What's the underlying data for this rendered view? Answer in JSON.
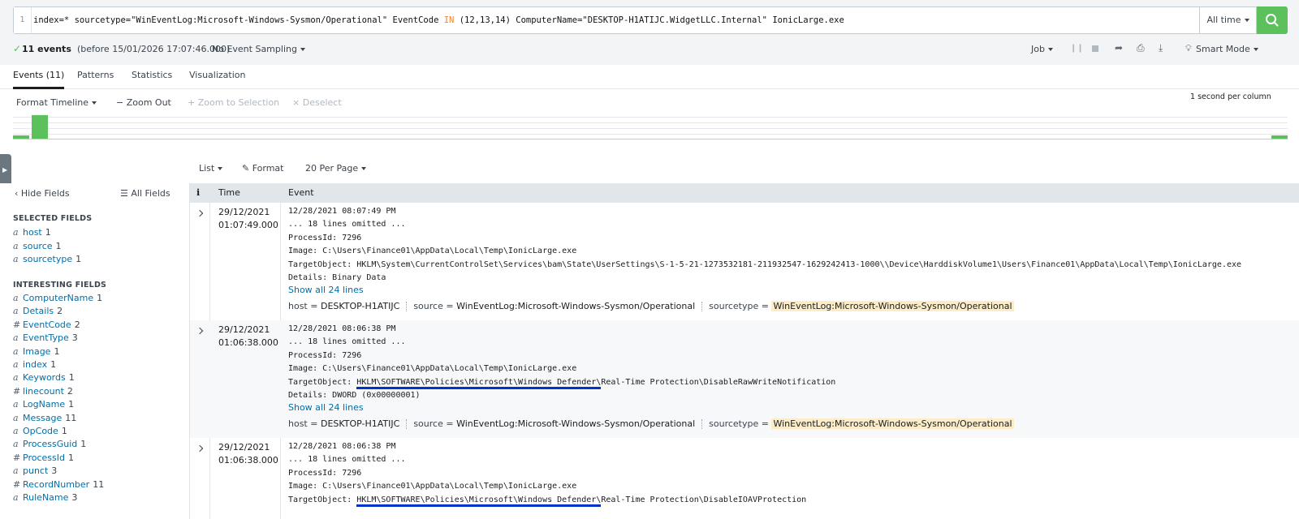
{
  "search": {
    "line_number": "1",
    "query_prefix": "index=* sourcetype=\"WinEventLog:Microsoft-Windows-Sysmon/Operational\" EventCode ",
    "query_keyword": "IN",
    "query_suffix": " (12,13,14) ComputerName=\"DESKTOP-H1ATIJC.WidgetLLC.Internal\" IonicLarge.exe",
    "time_range": "All time",
    "search_icon": "search-icon"
  },
  "status": {
    "event_count": "11 events",
    "before_text": "(before 15/01/2026 17:07:46.000)",
    "sampling": "No Event Sampling",
    "job": "Job",
    "mode": "Smart Mode"
  },
  "tabs": [
    "Events (11)",
    "Patterns",
    "Statistics",
    "Visualization"
  ],
  "timeline": {
    "format": "Format Timeline",
    "zoom_out": "Zoom Out",
    "zoom_selection": "+ Zoom to Selection",
    "deselect": "Deselect",
    "scale": "1 second per column",
    "accent": "#5cc05c"
  },
  "results_toolbar": {
    "list": "List",
    "format": "Format",
    "per_page": "20 Per Page"
  },
  "sidebar": {
    "hide_fields": "Hide Fields",
    "all_fields": "All Fields",
    "selected_heading": "SELECTED FIELDS",
    "interesting_heading": "INTERESTING FIELDS",
    "selected": [
      {
        "type": "a",
        "name": "host",
        "count": "1"
      },
      {
        "type": "a",
        "name": "source",
        "count": "1"
      },
      {
        "type": "a",
        "name": "sourcetype",
        "count": "1"
      }
    ],
    "interesting": [
      {
        "type": "a",
        "name": "ComputerName",
        "count": "1"
      },
      {
        "type": "a",
        "name": "Details",
        "count": "2"
      },
      {
        "type": "#",
        "name": "EventCode",
        "count": "2"
      },
      {
        "type": "a",
        "name": "EventType",
        "count": "3"
      },
      {
        "type": "a",
        "name": "Image",
        "count": "1"
      },
      {
        "type": "a",
        "name": "index",
        "count": "1"
      },
      {
        "type": "a",
        "name": "Keywords",
        "count": "1"
      },
      {
        "type": "#",
        "name": "linecount",
        "count": "2"
      },
      {
        "type": "a",
        "name": "LogName",
        "count": "1"
      },
      {
        "type": "a",
        "name": "Message",
        "count": "11"
      },
      {
        "type": "a",
        "name": "OpCode",
        "count": "1"
      },
      {
        "type": "a",
        "name": "ProcessGuid",
        "count": "1"
      },
      {
        "type": "#",
        "name": "ProcessId",
        "count": "1"
      },
      {
        "type": "a",
        "name": "punct",
        "count": "3"
      },
      {
        "type": "#",
        "name": "RecordNumber",
        "count": "11"
      },
      {
        "type": "a",
        "name": "RuleName",
        "count": "3"
      }
    ]
  },
  "table": {
    "col_info": "i",
    "col_time": "Time",
    "col_event": "Event"
  },
  "events": [
    {
      "date": "29/12/2021",
      "time": "01:07:49.000",
      "lines": [
        "12/28/2021 08:07:49 PM",
        "... 18 lines omitted ...",
        "ProcessId: 7296",
        "Image: C:\\Users\\Finance01\\AppData\\Local\\Temp\\IonicLarge.exe",
        "TargetObject: HKLM\\System\\CurrentControlSet\\Services\\bam\\State\\UserSettings\\S-1-5-21-1273532181-211932547-1629242413-1000\\\\Device\\HarddiskVolume1\\Users\\Finance01\\AppData\\Local\\Temp\\IonicLarge.exe",
        "Details: Binary Data"
      ],
      "show_all": "Show all 24 lines",
      "host": "DESKTOP-H1ATIJC",
      "source": "WinEventLog:Microsoft-Windows-Sysmon/Operational",
      "sourcetype": "WinEventLog:Microsoft-Windows-Sysmon/Operational"
    },
    {
      "date": "29/12/2021",
      "time": "01:06:38.000",
      "lines": [
        "12/28/2021 08:06:38 PM",
        "... 18 lines omitted ...",
        "ProcessId: 7296",
        "Image: C:\\Users\\Finance01\\AppData\\Local\\Temp\\IonicLarge.exe"
      ],
      "target_prefix": "TargetObject: ",
      "target_underlined": "HKLM\\SOFTWARE\\Policies\\Microsoft\\Windows Defender\\",
      "target_rest": "Real-Time Protection\\DisableRawWriteNotification",
      "details": "Details: DWORD (0x00000001)",
      "show_all": "Show all 24 lines",
      "host": "DESKTOP-H1ATIJC",
      "source": "WinEventLog:Microsoft-Windows-Sysmon/Operational",
      "sourcetype": "WinEventLog:Microsoft-Windows-Sysmon/Operational"
    },
    {
      "date": "29/12/2021",
      "time": "01:06:38.000",
      "lines": [
        "12/28/2021 08:06:38 PM",
        "... 18 lines omitted ...",
        "ProcessId: 7296",
        "Image: C:\\Users\\Finance01\\AppData\\Local\\Temp\\IonicLarge.exe"
      ],
      "target_prefix": "TargetObject: ",
      "target_underlined": "HKLM\\SOFTWARE\\Policies\\Microsoft\\Windows Defender\\",
      "target_rest": "Real-Time Protection\\DisableIOAVProtection"
    }
  ],
  "kv_labels": {
    "host": "host = ",
    "source": "source = ",
    "sourcetype": "sourcetype = "
  }
}
